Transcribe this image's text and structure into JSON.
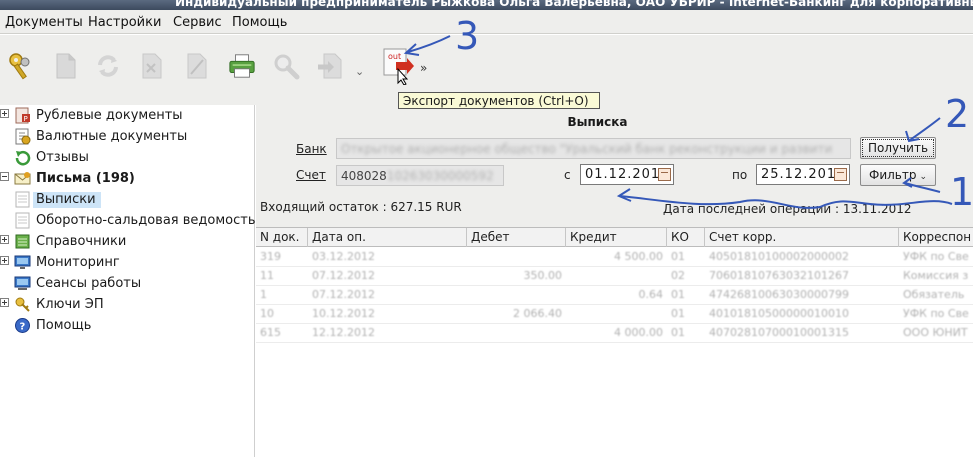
{
  "window": {
    "title": "Индивидуальный предприниматель Рыжкова Ольга Валерьевна, ОАО УБРИР - Internet-Банкинг для корпоративных"
  },
  "menu": {
    "items": [
      "Документы",
      "Настройки",
      "Сервис",
      "Помощь"
    ]
  },
  "toolbar": {
    "export_tooltip": "Экспорт документов (Ctrl+O)",
    "export_icon_text": "out",
    "more_glyph": "»"
  },
  "sidebar": {
    "items": [
      {
        "label": "Рублевые документы",
        "icon": "ruble-doc-icon",
        "expander": "plus"
      },
      {
        "label": "Валютные документы",
        "icon": "currency-doc-icon",
        "expander": ""
      },
      {
        "label": "Отзывы",
        "icon": "recall-icon",
        "expander": ""
      },
      {
        "label": "Письма (198)",
        "icon": "letter-icon",
        "expander": "minus"
      },
      {
        "label": "Выписки",
        "icon": "statement-icon",
        "expander": ""
      },
      {
        "label": "Оборотно-сальдовая ведомость",
        "icon": "balance-sheet-icon",
        "expander": ""
      },
      {
        "label": "Справочники",
        "icon": "directory-icon",
        "expander": "plus"
      },
      {
        "label": "Мониторинг",
        "icon": "monitoring-icon",
        "expander": "plus"
      },
      {
        "label": "Сеансы работы",
        "icon": "sessions-icon",
        "expander": ""
      },
      {
        "label": "Ключи ЭП",
        "icon": "key-icon",
        "expander": "plus"
      },
      {
        "label": "Помощь",
        "icon": "help-icon",
        "expander": ""
      }
    ]
  },
  "statement": {
    "title": "Выписка",
    "bank_label": "Банк",
    "bank_value": "Открытое акционерное общество \"Уральский банк реконструкции и развити",
    "account_label": "Счет",
    "account_prefix": "408028",
    "account_rest": "10263030000592",
    "from_label": "с",
    "from_date": "01.12.201",
    "to_label": "по",
    "to_date": "25.12.201",
    "get_button": "Получить",
    "filter_button": "Фильтр",
    "incoming_balance": "Входящий остаток : 627.15 RUR",
    "last_operation": "Дата последней операции : 13.11.2012"
  },
  "grid": {
    "columns": [
      "N док.",
      "Дата оп.",
      "Дебет",
      "Кредит",
      "КО",
      "Счет корр.",
      "Корреспон"
    ],
    "rows": [
      [
        "319",
        "03.12.2012",
        "",
        "4 500.00",
        "01",
        "40501810100002000002",
        "УФК по Све"
      ],
      [
        "11",
        "07.12.2012",
        "350.00",
        "",
        "02",
        "70601810763032101267",
        "Комиссия з"
      ],
      [
        "1",
        "07.12.2012",
        "",
        "0.64",
        "01",
        "47426810063030000799",
        "Обязатель"
      ],
      [
        "10",
        "10.12.2012",
        "2 066.40",
        "",
        "01",
        "40101810500000010010",
        "УФК по Све"
      ],
      [
        "615",
        "12.12.2012",
        "",
        "4 000.00",
        "01",
        "40702810700010001315",
        "ООО ЮНИТ"
      ]
    ]
  },
  "annotations": {
    "n1": "1",
    "n2": "2",
    "n3": "3",
    "color": "#3558b8"
  }
}
